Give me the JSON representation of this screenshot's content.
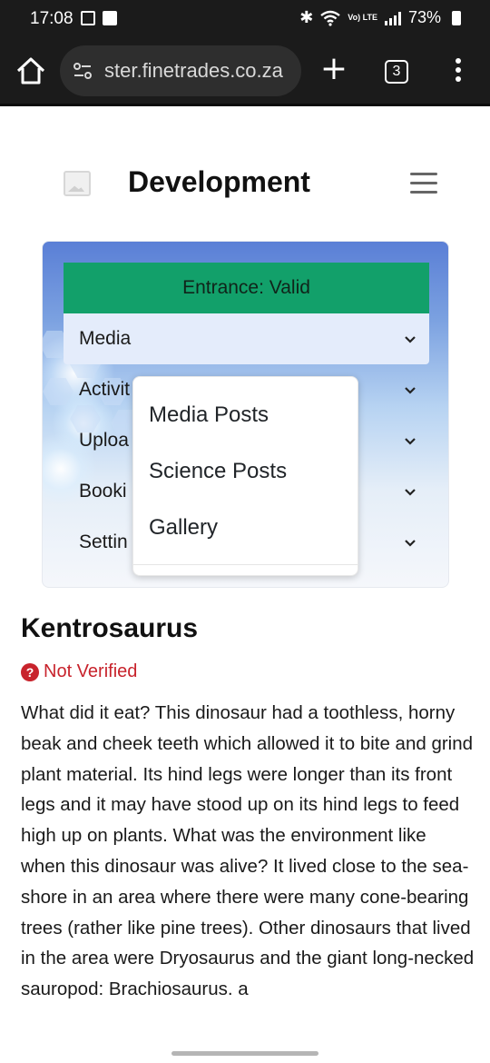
{
  "status_bar": {
    "time": "17:08",
    "network_label": "Vo) LTE",
    "battery": "73%"
  },
  "browser": {
    "url": "ster.finetrades.co.za",
    "tab_count": "3",
    "plus": "+"
  },
  "header": {
    "title": "Development"
  },
  "nav": {
    "entrance": "Entrance: Valid",
    "items": [
      {
        "label": "Media"
      },
      {
        "label": "Activit"
      },
      {
        "label": "Uploa"
      },
      {
        "label": "Booki"
      },
      {
        "label": "Settin"
      }
    ],
    "dropdown": [
      {
        "label": "Media Posts"
      },
      {
        "label": "Science Posts"
      },
      {
        "label": "Gallery"
      }
    ]
  },
  "article": {
    "title": "Kentrosaurus",
    "status": "Not Verified",
    "status_icon": "?",
    "body": "What did it eat? This dinosaur had a toothless, horny beak and cheek teeth which allowed it to bite and grind plant material. Its hind legs were longer than its front legs and it may have stood up on its hind legs to feed high up on plants. What was the environment like when this dinosaur was alive? It lived close to the sea-shore in an area where there were many cone-bearing trees (rather like pine trees). Other dinosaurs that lived in the area were Dryosaurus and the giant long-necked sauropod: Brachiosaurus. a"
  },
  "colors": {
    "entrance_bg": "#12a06a",
    "status_red": "#c8232c",
    "active_item_bg": "#e4ecfb"
  }
}
